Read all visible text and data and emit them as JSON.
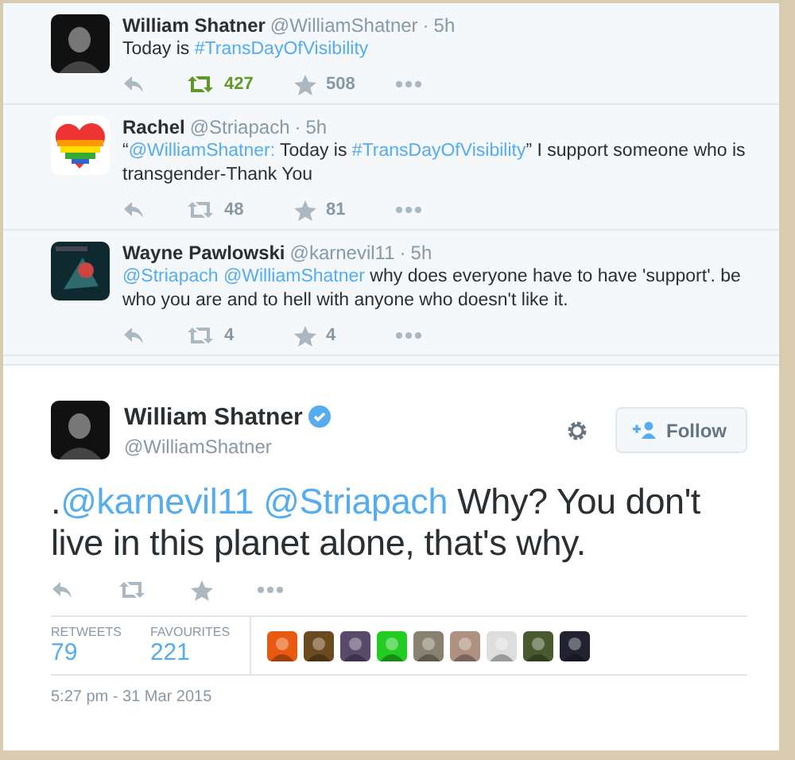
{
  "replies": [
    {
      "name": "William Shatner",
      "handle": "@WilliamShatner",
      "separator": "·",
      "time": "5h",
      "avatar": {
        "kind": "picture"
      },
      "text": [
        {
          "kind": "plain",
          "text": "Today is "
        },
        {
          "kind": "link",
          "text": "#TransDayOfVisibility"
        }
      ],
      "retweets": "427",
      "retweeted": true,
      "favourites": "508",
      "favourited": false
    },
    {
      "name": "Rachel",
      "handle": "@Striapach",
      "separator": "·",
      "time": "5h",
      "avatar": {
        "kind": "picture"
      },
      "text": [
        {
          "kind": "plain",
          "text": "“"
        },
        {
          "kind": "link",
          "text": "@WilliamShatner:"
        },
        {
          "kind": "plain",
          "text": " Today is "
        },
        {
          "kind": "link",
          "text": "#TransDayOfVisibility"
        },
        {
          "kind": "plain",
          "text": "” I support someone who is transgender-Thank You"
        }
      ],
      "retweets": "48",
      "retweeted": false,
      "favourites": "81",
      "favourited": false
    },
    {
      "name": "Wayne Pawlowski",
      "handle": "@karnevil11",
      "separator": "·",
      "time": "5h",
      "avatar": {
        "kind": "picture"
      },
      "text": [
        {
          "kind": "link",
          "text": "@Striapach"
        },
        {
          "kind": "link",
          "text": "@WilliamShatner",
          "space_before": true
        },
        {
          "kind": "plain",
          "text": " why does everyone have to have 'support'.  be who you are and to hell with anyone who doesn't like it."
        }
      ],
      "retweets": "4",
      "retweeted": false,
      "favourites": "4",
      "favourited": false
    }
  ],
  "tweet": {
    "name": "William Shatner",
    "verified": true,
    "handle": "@WilliamShatner",
    "avatar": {
      "kind": "picture"
    },
    "follow_button": "Follow",
    "text": [
      {
        "kind": "plain",
        "text": "."
      },
      {
        "kind": "link",
        "text": "@karnevil11"
      },
      {
        "kind": "link",
        "text": "@Striapach",
        "space_before": true
      },
      {
        "kind": "plain",
        "text": " Why? You don't live in this planet alone, that's why."
      }
    ],
    "stats": [
      {
        "label": "RETWEETS",
        "value": "79"
      },
      {
        "label": "FAVOURITES",
        "value": "221"
      }
    ],
    "favouriters": [
      {
        "kind": "picture"
      },
      {
        "kind": "picture"
      },
      {
        "kind": "picture"
      },
      {
        "kind": "picture"
      },
      {
        "kind": "picture"
      },
      {
        "kind": "picture"
      },
      {
        "kind": "picture"
      },
      {
        "kind": "picture"
      },
      {
        "kind": "picture"
      }
    ],
    "timestamp": "5:27 pm - 31 Mar 2015"
  }
}
